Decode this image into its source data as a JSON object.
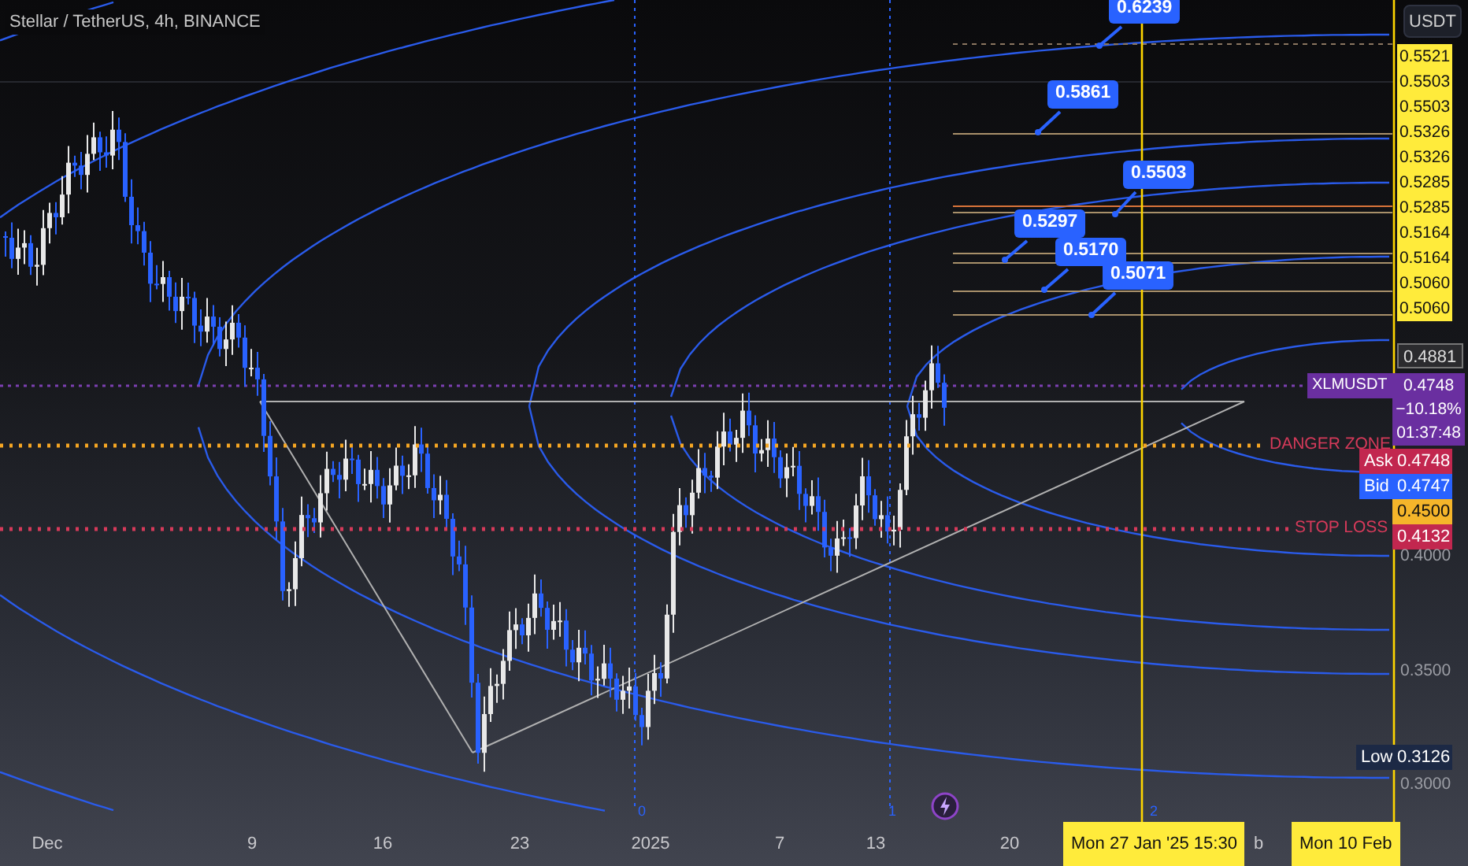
{
  "header": {
    "title": "Stellar / TetherUS, 4h, BINANCE"
  },
  "currency_button": "USDT",
  "fib_price_labels": [
    "0.5521",
    "0.5503",
    "0.5503",
    "0.5326",
    "0.5326",
    "0.5285",
    "0.5285",
    "0.5164",
    "0.5164",
    "0.5060",
    "0.5060"
  ],
  "high_price_box": "0.4881",
  "symbol_tag": {
    "symbol": "XLMUSDT",
    "price": "0.4748",
    "change": "−10.18%",
    "countdown": "01:37:48"
  },
  "quote_tags": [
    {
      "kind": "ask",
      "label": "Ask",
      "value": "0.4748"
    },
    {
      "kind": "bid",
      "label": "Bid",
      "value": "0.4747"
    },
    {
      "kind": "alert",
      "value": "0.4500"
    },
    {
      "kind": "stop",
      "value": "0.4132"
    }
  ],
  "axis_ticks": [
    "0.4000",
    "0.3500",
    "0.3000"
  ],
  "low_tag": {
    "label": "Low",
    "value": "0.3126"
  },
  "level_lines": [
    {
      "kind": "danger",
      "label": "DANGER ZONE"
    },
    {
      "kind": "stop",
      "label": "STOP LOSS"
    }
  ],
  "callouts": [
    "0.6239",
    "0.5861",
    "0.5503",
    "0.5297",
    "0.5170",
    "0.5071"
  ],
  "cycle_markers": [
    "0",
    "1",
    "2"
  ],
  "time_axis": {
    "ticks": [
      "Dec",
      "9",
      "16",
      "23",
      "2025",
      "7",
      "13",
      "20",
      "b"
    ],
    "cursor_labels": [
      "Mon 27 Jan '25 15:30",
      "Mon 10 Feb"
    ]
  }
}
